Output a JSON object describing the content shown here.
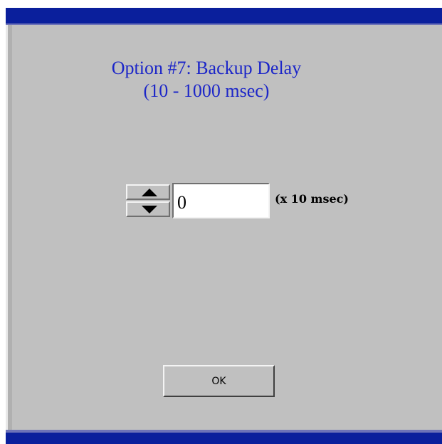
{
  "dialog": {
    "title_line1": "Option #7: Backup Delay",
    "title_line2": "(10 - 1000 msec)",
    "title_color": "#1c26c8",
    "bar_color": "#0a1f9c",
    "panel_color": "#c0c0c0"
  },
  "delay_input": {
    "value": "0",
    "units": "(x 10 msec)"
  },
  "spinner": {
    "up_icon": "triangle-up-icon",
    "down_icon": "triangle-down-icon"
  },
  "ok_button": {
    "label": "OK"
  }
}
